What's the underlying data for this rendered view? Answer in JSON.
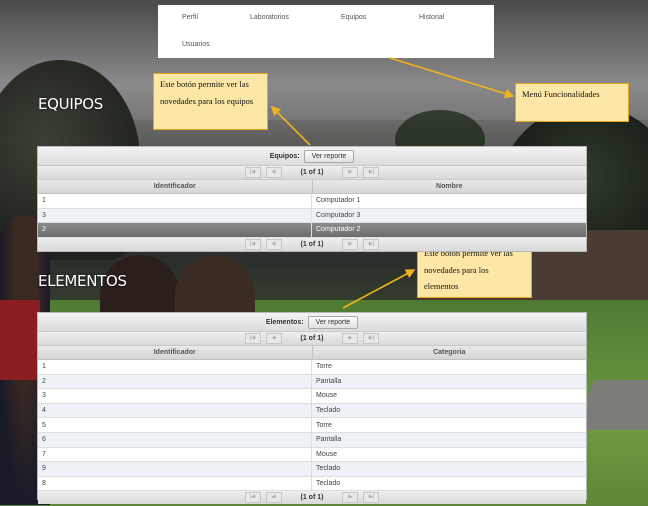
{
  "nav": {
    "items": [
      "Perfil",
      "Laboratorios",
      "Equipos",
      "Historial",
      "Usuarios"
    ]
  },
  "annotations": {
    "menu_note": "Menú Funcionalidades",
    "equipos_note": "Este botón permite ver las novedades para los equipos",
    "elementos_note": "Este botón permite ver las novedades para los elementos"
  },
  "equipos": {
    "title": "EQUIPOS",
    "caption_label": "Equipos:",
    "report_button": "Ver reporte",
    "pager_text": "(1 of 1)",
    "columns": [
      "Identificador",
      "Nombre"
    ],
    "rows": [
      {
        "id": "1",
        "name": "Computador 1"
      },
      {
        "id": "3",
        "name": "Computador 3"
      },
      {
        "id": "2",
        "name": "Computador 2",
        "selected": true
      }
    ]
  },
  "elementos": {
    "title": "ELEMENTOS",
    "caption_label": "Elementos:",
    "report_button": "Ver reporte",
    "pager_text": "(1 of 1)",
    "columns": [
      "Identificador",
      "Categoria"
    ],
    "rows": [
      {
        "id": "1",
        "cat": "Torre"
      },
      {
        "id": "2",
        "cat": "Pantalla"
      },
      {
        "id": "3",
        "cat": "Mouse"
      },
      {
        "id": "4",
        "cat": "Teclado"
      },
      {
        "id": "5",
        "cat": "Torre"
      },
      {
        "id": "6",
        "cat": "Pantalla"
      },
      {
        "id": "7",
        "cat": "Mouse"
      },
      {
        "id": "9",
        "cat": "Teclado"
      },
      {
        "id": "8",
        "cat": "Teclado"
      }
    ]
  },
  "pager_icons": [
    "first-page-icon",
    "prev-page-icon",
    "next-page-icon",
    "last-page-icon"
  ],
  "colors": {
    "note_fill": "#fde7a7",
    "note_border": "#e8a21c",
    "arrow": "#f2b21c",
    "selected_row": "#7a7a7a"
  }
}
